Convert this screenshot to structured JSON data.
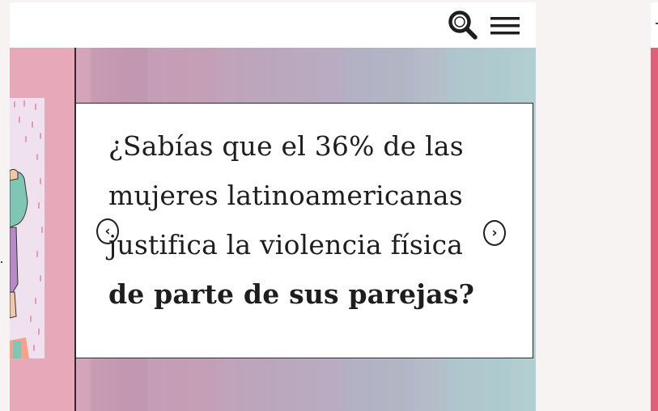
{
  "header": {
    "search_icon": "search-icon",
    "menu_icon": "hamburger-menu-icon"
  },
  "carousel": {
    "slide": {
      "lines": [
        "¿Sabías que el 36% de las",
        "mujeres latinoamericanas",
        "justifica la violencia física"
      ],
      "bold_line": "de parte de sus parejas?"
    },
    "prev_label": "‹",
    "next_label": "›"
  },
  "colors": {
    "header_bg": "#ffffff",
    "card_bg": "#ffffff",
    "text": "#1e1e1e",
    "pink_band": "#e7a9ba",
    "accent_red": "#de6277"
  }
}
